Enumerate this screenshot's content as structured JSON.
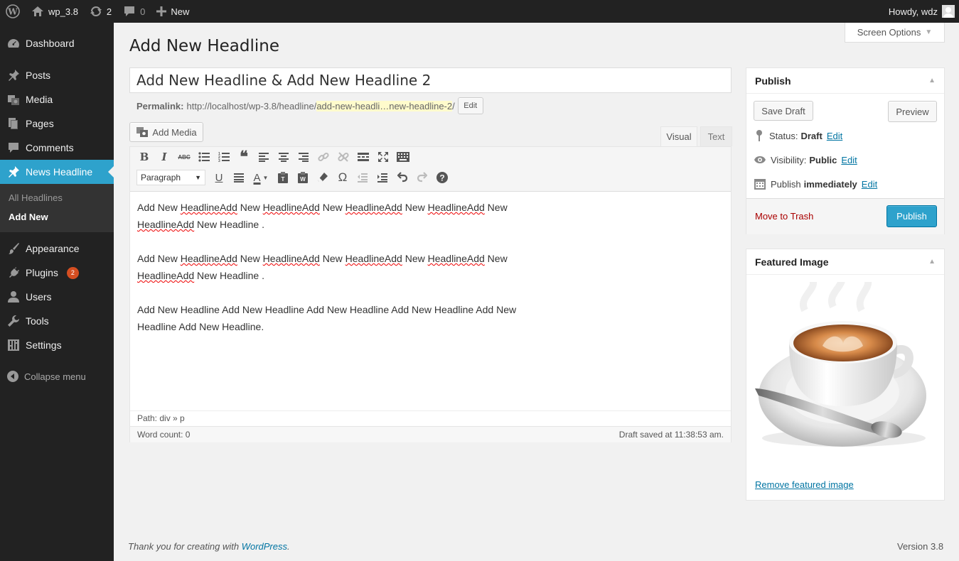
{
  "admin_bar": {
    "site_name": "wp_3.8",
    "updates_count": "2",
    "comments_count": "0",
    "new_label": "New",
    "howdy": "Howdy, wdz"
  },
  "sidebar": {
    "items": [
      {
        "label": "Dashboard",
        "icon": "dashboard-icon"
      },
      {
        "label": "Posts",
        "icon": "pin-icon"
      },
      {
        "label": "Media",
        "icon": "media-icon"
      },
      {
        "label": "Pages",
        "icon": "pages-icon"
      },
      {
        "label": "Comments",
        "icon": "comment-icon"
      },
      {
        "label": "News Headline",
        "icon": "pin-icon"
      },
      {
        "label": "Appearance",
        "icon": "brush-icon"
      },
      {
        "label": "Plugins",
        "icon": "plug-icon",
        "badge": "2"
      },
      {
        "label": "Users",
        "icon": "user-icon"
      },
      {
        "label": "Tools",
        "icon": "wrench-icon"
      },
      {
        "label": "Settings",
        "icon": "settings-icon"
      }
    ],
    "submenu": [
      "All Headlines",
      "Add New"
    ],
    "collapse": "Collapse menu"
  },
  "screen_options": "Screen Options",
  "page_title": "Add New Headline",
  "post_title": "Add New Headline & Add New Headline 2",
  "permalink": {
    "label": "Permalink:",
    "base": "http://localhost/wp-3.8/headline/",
    "slug": "add-new-headli…new-headline-2",
    "trail": "/",
    "edit": "Edit"
  },
  "editor": {
    "add_media": "Add Media",
    "tab_visual": "Visual",
    "tab_text": "Text",
    "format": "Paragraph",
    "paragraphs": [
      "Add New HeadlineAdd New HeadlineAdd New HeadlineAdd New HeadlineAdd New HeadlineAdd New Headline .",
      "Add New HeadlineAdd New HeadlineAdd New HeadlineAdd New HeadlineAdd New HeadlineAdd New Headline .",
      "Add New Headline Add New Headline Add New Headline Add New Headline Add New Headline Add New Headline."
    ],
    "path": "Path: div » p",
    "word_count": "Word count: 0",
    "draft_saved": "Draft saved at 11:38:53 am."
  },
  "publish": {
    "title": "Publish",
    "save_draft": "Save Draft",
    "preview": "Preview",
    "status_label": "Status:",
    "status_value": "Draft",
    "visibility_label": "Visibility:",
    "visibility_value": "Public",
    "schedule_label": "Publish",
    "schedule_value": "immediately",
    "edit": "Edit",
    "trash": "Move to Trash",
    "publish_button": "Publish"
  },
  "featured_image": {
    "title": "Featured Image",
    "remove": "Remove featured image"
  },
  "footer": {
    "thanks": "Thank you for creating with",
    "wp_link": "WordPress",
    "period": ".",
    "version": "Version 3.8"
  },
  "colors": {
    "accent": "#2ea2cc",
    "admin_dark": "#222222",
    "link": "#0074a2",
    "trash": "#aa0000"
  }
}
